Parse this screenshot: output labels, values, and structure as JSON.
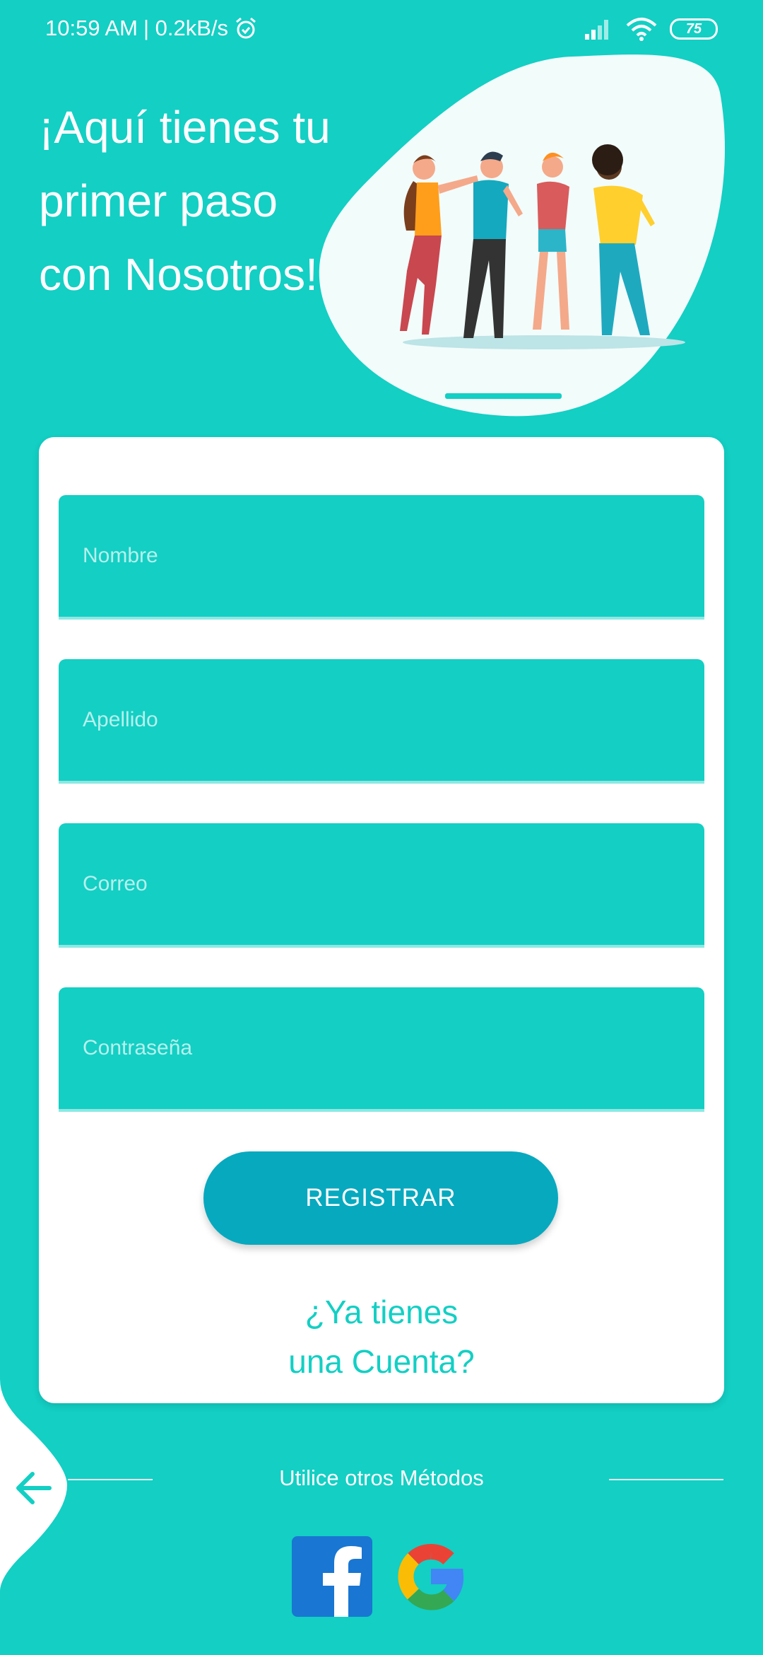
{
  "status_bar": {
    "time": "10:59 AM",
    "network_speed": "| 0.2kB/s",
    "battery": "75",
    "icons": [
      "alarm-icon",
      "signal-icon",
      "wifi-icon",
      "battery-icon"
    ]
  },
  "header": {
    "title": "¡Aquí tienes tu primer paso con Nosotros!"
  },
  "form": {
    "fields": [
      {
        "placeholder": "Nombre",
        "value": ""
      },
      {
        "placeholder": "Apellido",
        "value": ""
      },
      {
        "placeholder": "Correo",
        "value": ""
      },
      {
        "placeholder": "Contraseña",
        "value": ""
      }
    ],
    "register_label": "REGISTRAR",
    "login_link_line1": "¿Ya tienes",
    "login_link_line2": "una Cuenta?"
  },
  "footer": {
    "other_methods_label": "Utilice otros Métodos",
    "social": [
      "facebook-icon",
      "google-icon"
    ]
  },
  "colors": {
    "background": "#13cfc4",
    "button": "#07a9bf",
    "link": "#13cfc4",
    "card": "#ffffff"
  }
}
